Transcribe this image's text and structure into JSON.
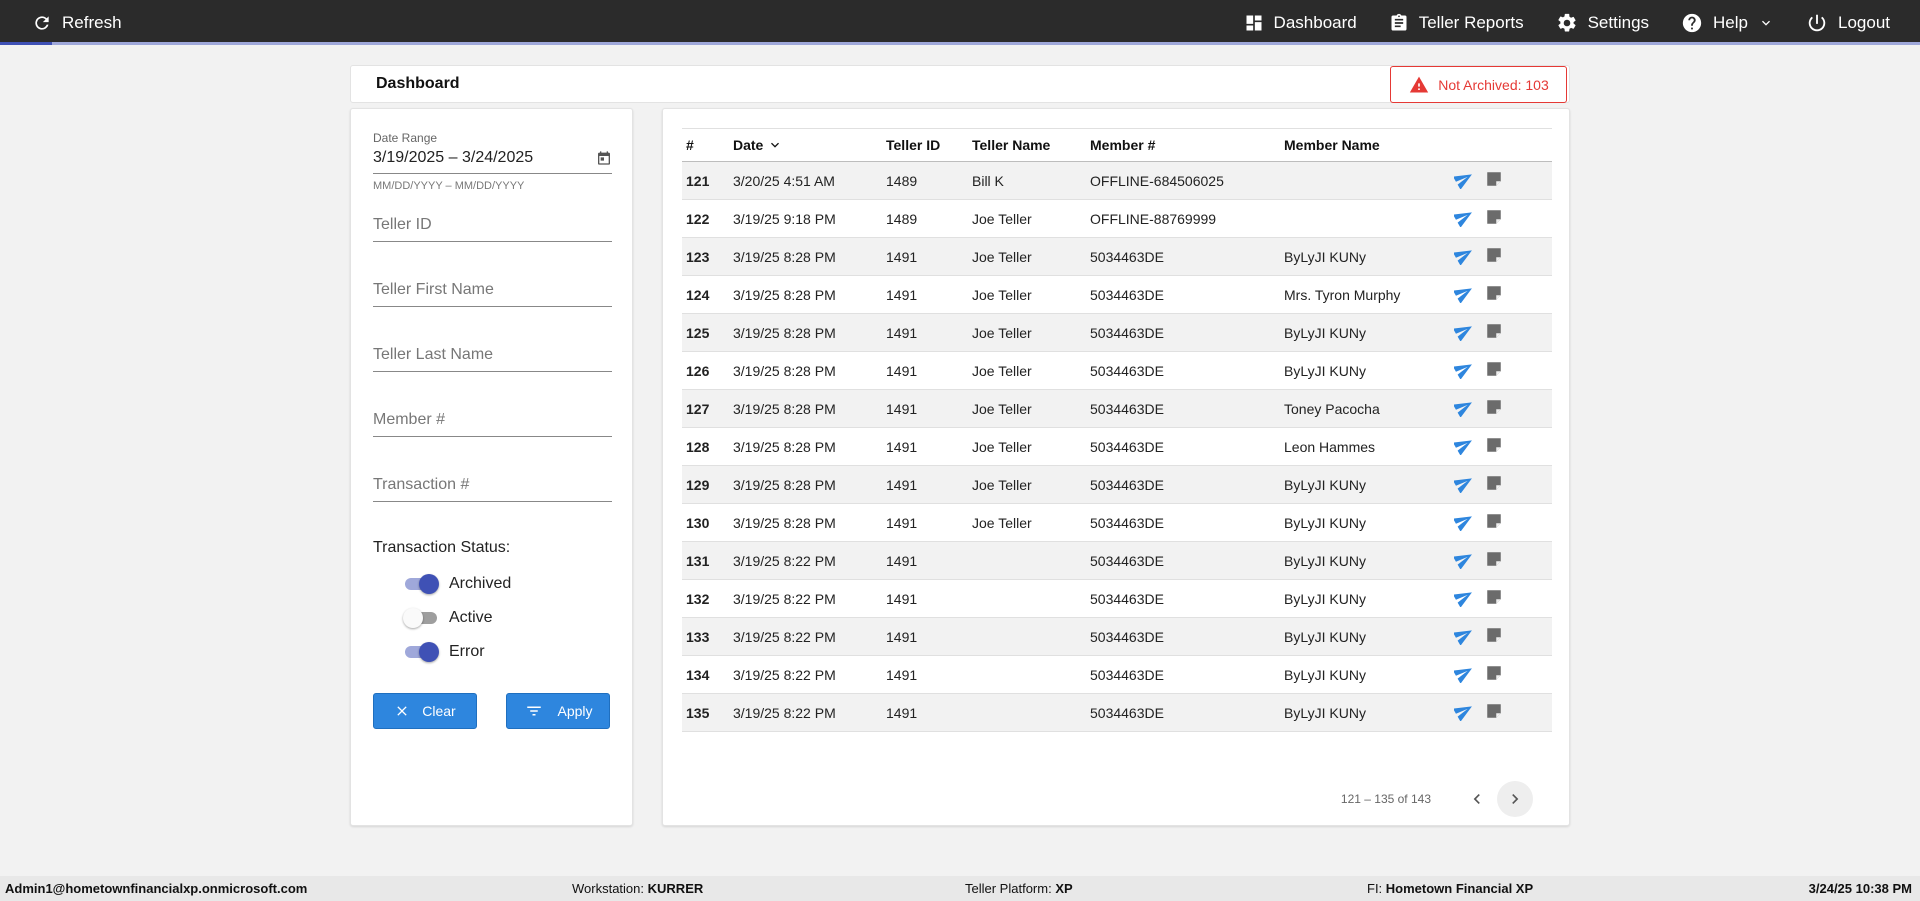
{
  "nav": {
    "refresh_label": "Refresh",
    "progress_fraction": 0.027,
    "items": [
      {
        "label": "Dashboard",
        "icon": "dashboard-icon"
      },
      {
        "label": "Teller Reports",
        "icon": "clipboard-icon"
      },
      {
        "label": "Settings",
        "icon": "gear-icon"
      },
      {
        "label": "Help",
        "icon": "help-icon"
      },
      {
        "label": "Logout",
        "icon": "power-icon"
      }
    ]
  },
  "header": {
    "title": "Dashboard",
    "alert_text": "Not Archived: 103"
  },
  "filters": {
    "date_range_label": "Date Range",
    "date_range_value": "3/19/2025 – 3/24/2025",
    "date_range_hint": "MM/DD/YYYY – MM/DD/YYYY",
    "teller_id_placeholder": "Teller ID",
    "teller_first_name_placeholder": "Teller First Name",
    "teller_last_name_placeholder": "Teller Last Name",
    "member_number_placeholder": "Member #",
    "transaction_number_placeholder": "Transaction #",
    "status_title": "Transaction Status:",
    "statuses": [
      {
        "label": "Archived",
        "on": true
      },
      {
        "label": "Active",
        "on": false
      },
      {
        "label": "Error",
        "on": true
      }
    ],
    "clear_label": "Clear",
    "apply_label": "Apply"
  },
  "table": {
    "columns": [
      "#",
      "Date",
      "Teller ID",
      "Teller Name",
      "Member #",
      "Member Name"
    ],
    "rows": [
      [
        "121",
        "3/20/25 4:51 AM",
        "1489",
        "Bill K",
        "OFFLINE-684506025",
        ""
      ],
      [
        "122",
        "3/19/25 9:18 PM",
        "1489",
        "Joe Teller",
        "OFFLINE-88769999",
        ""
      ],
      [
        "123",
        "3/19/25 8:28 PM",
        "1491",
        "Joe Teller",
        "5034463DE",
        "ByLyJI KUNy"
      ],
      [
        "124",
        "3/19/25 8:28 PM",
        "1491",
        "Joe Teller",
        "5034463DE",
        "Mrs. Tyron Murphy"
      ],
      [
        "125",
        "3/19/25 8:28 PM",
        "1491",
        "Joe Teller",
        "5034463DE",
        "ByLyJI KUNy"
      ],
      [
        "126",
        "3/19/25 8:28 PM",
        "1491",
        "Joe Teller",
        "5034463DE",
        "ByLyJI KUNy"
      ],
      [
        "127",
        "3/19/25 8:28 PM",
        "1491",
        "Joe Teller",
        "5034463DE",
        "Toney Pacocha"
      ],
      [
        "128",
        "3/19/25 8:28 PM",
        "1491",
        "Joe Teller",
        "5034463DE",
        "Leon Hammes"
      ],
      [
        "129",
        "3/19/25 8:28 PM",
        "1491",
        "Joe Teller",
        "5034463DE",
        "ByLyJI KUNy"
      ],
      [
        "130",
        "3/19/25 8:28 PM",
        "1491",
        "Joe Teller",
        "5034463DE",
        "ByLyJI KUNy"
      ],
      [
        "131",
        "3/19/25 8:22 PM",
        "1491",
        "",
        "5034463DE",
        "ByLyJI KUNy"
      ],
      [
        "132",
        "3/19/25 8:22 PM",
        "1491",
        "",
        "5034463DE",
        "ByLyJI KUNy"
      ],
      [
        "133",
        "3/19/25 8:22 PM",
        "1491",
        "",
        "5034463DE",
        "ByLyJI KUNy"
      ],
      [
        "134",
        "3/19/25 8:22 PM",
        "1491",
        "",
        "5034463DE",
        "ByLyJI KUNy"
      ],
      [
        "135",
        "3/19/25 8:22 PM",
        "1491",
        "",
        "5034463DE",
        "ByLyJI KUNy"
      ]
    ],
    "pager_range": "121 – 135 of 143"
  },
  "footer": {
    "user": "Admin1@hometownfinancialxp.onmicrosoft.com",
    "workstation_label": "Workstation:",
    "workstation_value": "KURRER",
    "platform_label": "Teller Platform:",
    "platform_value": "XP",
    "fi_label": "FI:",
    "fi_value": "Hometown Financial XP",
    "datetime": "3/24/25 10:38 PM"
  },
  "colors": {
    "topbar": "#2b2b2b",
    "accent_blue": "#2e86de",
    "toggle_on": "#3f51b5",
    "alert_red": "#e53935"
  }
}
